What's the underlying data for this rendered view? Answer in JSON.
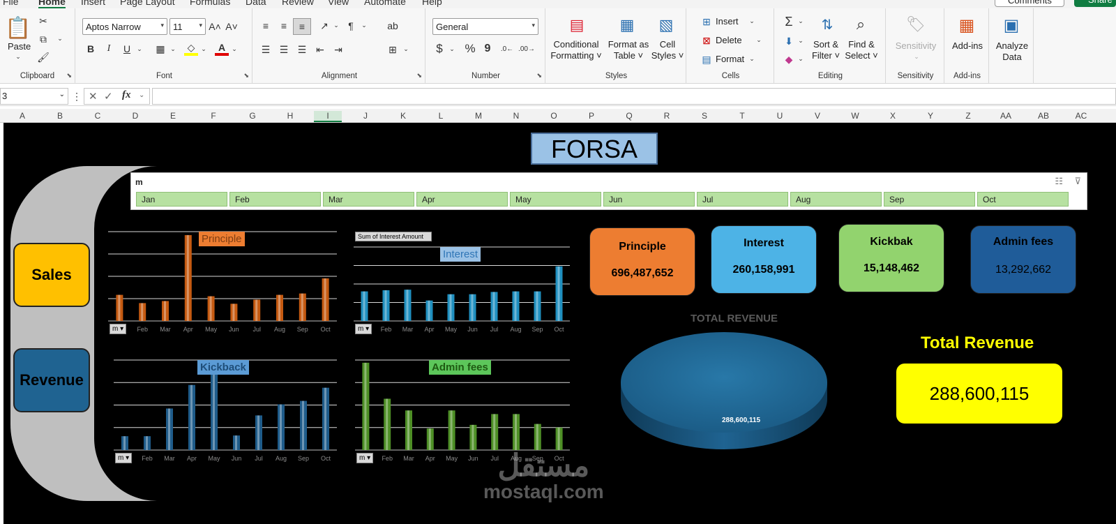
{
  "menu": {
    "items": [
      "File",
      "Home",
      "Insert",
      "Page Layout",
      "Formulas",
      "Data",
      "Review",
      "View",
      "Automate",
      "Help"
    ],
    "active": "Home",
    "comments_label": "Comments",
    "share_label": "Share"
  },
  "ribbon": {
    "clipboard": {
      "paste_label": "Paste",
      "group_label": "Clipboard"
    },
    "font": {
      "font_name": "Aptos Narrow",
      "font_size": "11",
      "bold": "B",
      "italic": "I",
      "underline": "U",
      "group_label": "Font"
    },
    "alignment": {
      "group_label": "Alignment"
    },
    "number": {
      "format": "General",
      "currency": "$",
      "percent": "%",
      "comma": "9",
      "group_label": "Number"
    },
    "styles": {
      "conditional_line1": "Conditional",
      "conditional_line2": "Formatting",
      "format_table_line1": "Format as",
      "format_table_line2": "Table",
      "cell_styles_line1": "Cell",
      "cell_styles_line2": "Styles",
      "group_label": "Styles"
    },
    "cells": {
      "insert_label": "Insert",
      "delete_label": "Delete",
      "format_label": "Format",
      "group_label": "Cells"
    },
    "editing": {
      "sort_line1": "Sort &",
      "sort_line2": "Filter",
      "find_line1": "Find &",
      "find_line2": "Select",
      "group_label": "Editing"
    },
    "sensitivity": {
      "label": "Sensitivity",
      "group_label": "Sensitivity"
    },
    "addins": {
      "label": "Add-ins",
      "group_label": "Add-ins"
    },
    "analyze": {
      "line1": "Analyze",
      "line2": "Data"
    },
    "accent_color": "#107c41"
  },
  "formula_bar": {
    "name_box": "3",
    "fx": "fx",
    "content": ""
  },
  "columns": [
    "A",
    "B",
    "C",
    "D",
    "E",
    "F",
    "G",
    "H",
    "I",
    "J",
    "K",
    "L",
    "M",
    "N",
    "O",
    "P",
    "Q",
    "R",
    "S",
    "T",
    "U",
    "V",
    "W",
    "X",
    "Y",
    "Z",
    "AA",
    "AB",
    "AC"
  ],
  "dashboard": {
    "title": "FORSA",
    "side_buttons": [
      {
        "label": "Sales",
        "color": "#ffc000"
      },
      {
        "label": "Revenue",
        "color": "#1f6391"
      }
    ],
    "slicer": {
      "title": "m",
      "items": [
        "Jan",
        "Feb",
        "Mar",
        "Apr",
        "May",
        "Jun",
        "Jul",
        "Aug",
        "Sep",
        "Oct"
      ]
    },
    "kpis": [
      {
        "label": "Principle",
        "value": "696,487,652",
        "color": "#ed7d31"
      },
      {
        "label": "Interest",
        "value": "260,158,991",
        "color": "#4db3e6"
      },
      {
        "label": "Kickbak",
        "value": "15,148,462",
        "color": "#92d36e"
      },
      {
        "label": "Admin fees",
        "value": "13,292,662",
        "color": "#1f5c99"
      }
    ],
    "pie": {
      "title": "TOTAL REVENUE",
      "value_label": "288,600,115",
      "color": "#1f6391"
    },
    "total_revenue": {
      "label": "Total Revenue",
      "value": "288,600,115",
      "label_color": "#ffff00",
      "box_color": "#ffff00"
    },
    "watermark": {
      "arabic": "مستقل",
      "latin": "mostaql.com"
    }
  },
  "chart_data": [
    {
      "type": "bar",
      "title": "Principle",
      "categories": [
        "Jan",
        "Feb",
        "Mar",
        "Apr",
        "May",
        "Jun",
        "Jul",
        "Aug",
        "Sep",
        "Oct"
      ],
      "tick_labels": [
        "m",
        "Feb",
        "Mar",
        "Apr",
        "May",
        "Jun",
        "Jul",
        "Aug",
        "Sep",
        "Oct"
      ],
      "values": [
        38,
        26,
        29,
        125,
        36,
        25,
        31,
        38,
        40,
        62
      ],
      "ylim": [
        0,
        130
      ],
      "color": "#c55a11",
      "title_bg": "#ed7d31",
      "filter_label": "m",
      "grid": true
    },
    {
      "type": "bar",
      "title": "Interest",
      "categories": [
        "Jan",
        "Feb",
        "Mar",
        "Apr",
        "May",
        "Jun",
        "Jul",
        "Aug",
        "Sep",
        "Oct"
      ],
      "tick_labels": [
        "m",
        "Feb",
        "Mar",
        "Apr",
        "May",
        "Jun",
        "Jul",
        "Aug",
        "Sep",
        "Oct"
      ],
      "values": [
        52,
        54,
        55,
        36,
        47,
        47,
        51,
        52,
        52,
        96
      ],
      "ylim": [
        0,
        130
      ],
      "color": "#1f8fbf",
      "title_bg": "#9bc2e6",
      "filter_label": "m",
      "field_button": "Sum of Interest Amount",
      "grid": true
    },
    {
      "type": "bar",
      "title": "Kickback",
      "categories": [
        "Jan",
        "Feb",
        "Mar",
        "Apr",
        "May",
        "Jun",
        "Jul",
        "Aug",
        "Sep",
        "Oct"
      ],
      "tick_labels": [
        "m",
        "Feb",
        "Mar",
        "Apr",
        "May",
        "Jun",
        "Jul",
        "Aug",
        "Sep",
        "Oct"
      ],
      "values": [
        20,
        20,
        60,
        94,
        130,
        21,
        50,
        66,
        71,
        90
      ],
      "ylim": [
        0,
        130
      ],
      "color": "#1f5c8a",
      "title_bg": "#5b9bd5",
      "filter_label": "m",
      "grid": true
    },
    {
      "type": "bar",
      "title": "Admin fees",
      "categories": [
        "Jan",
        "Feb",
        "Mar",
        "Apr",
        "May",
        "Jun",
        "Jul",
        "Aug",
        "Sep",
        "Oct"
      ],
      "tick_labels": [
        "m",
        "Feb",
        "Mar",
        "Apr",
        "May",
        "Jun",
        "Jul",
        "Aug",
        "Sep",
        "Oct"
      ],
      "values": [
        97,
        57,
        44,
        24,
        44,
        28,
        40,
        40,
        29,
        25
      ],
      "ylim": [
        0,
        100
      ],
      "color": "#4e8f26",
      "title_bg": "#5cc65a",
      "filter_label": "m",
      "grid": true
    },
    {
      "type": "pie",
      "title": "TOTAL REVENUE",
      "categories": [
        "Total Revenue"
      ],
      "values": [
        288600115
      ]
    }
  ]
}
